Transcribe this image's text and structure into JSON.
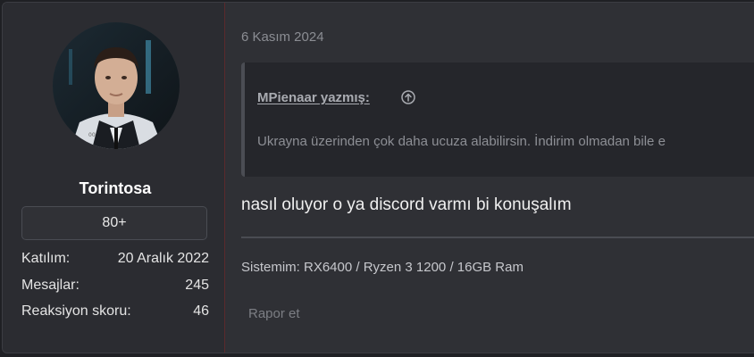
{
  "user": {
    "name": "Torintosa",
    "title": "80+",
    "stats": [
      {
        "label": "Katılım:",
        "value": "20 Aralık 2022"
      },
      {
        "label": "Mesajlar:",
        "value": "245"
      },
      {
        "label": "Reaksiyon skoru:",
        "value": "46"
      }
    ],
    "avatar_icon": "user-avatar-icon"
  },
  "post": {
    "date": "6 Kasım 2024",
    "quote": {
      "author": "MPienaar yazmış:",
      "text": "Ukrayna üzerinden çok daha ucuza alabilirsin. İndirim olmadan bile e",
      "arrow_icon": "arrow-up-circle-icon"
    },
    "message": "nasıl oluyor o ya discord varmı bi konuşalım",
    "signature": "Sistemim: RX6400 / Ryzen 3 1200 / 16GB Ram",
    "report_label": "Rapor et"
  },
  "colors": {
    "background": "#1f2024",
    "panel": "#2f3035",
    "user_panel": "#2b2c31",
    "divider_accent": "#5a2a2c",
    "text": "#f0f0f0",
    "muted": "#8b8d93"
  }
}
